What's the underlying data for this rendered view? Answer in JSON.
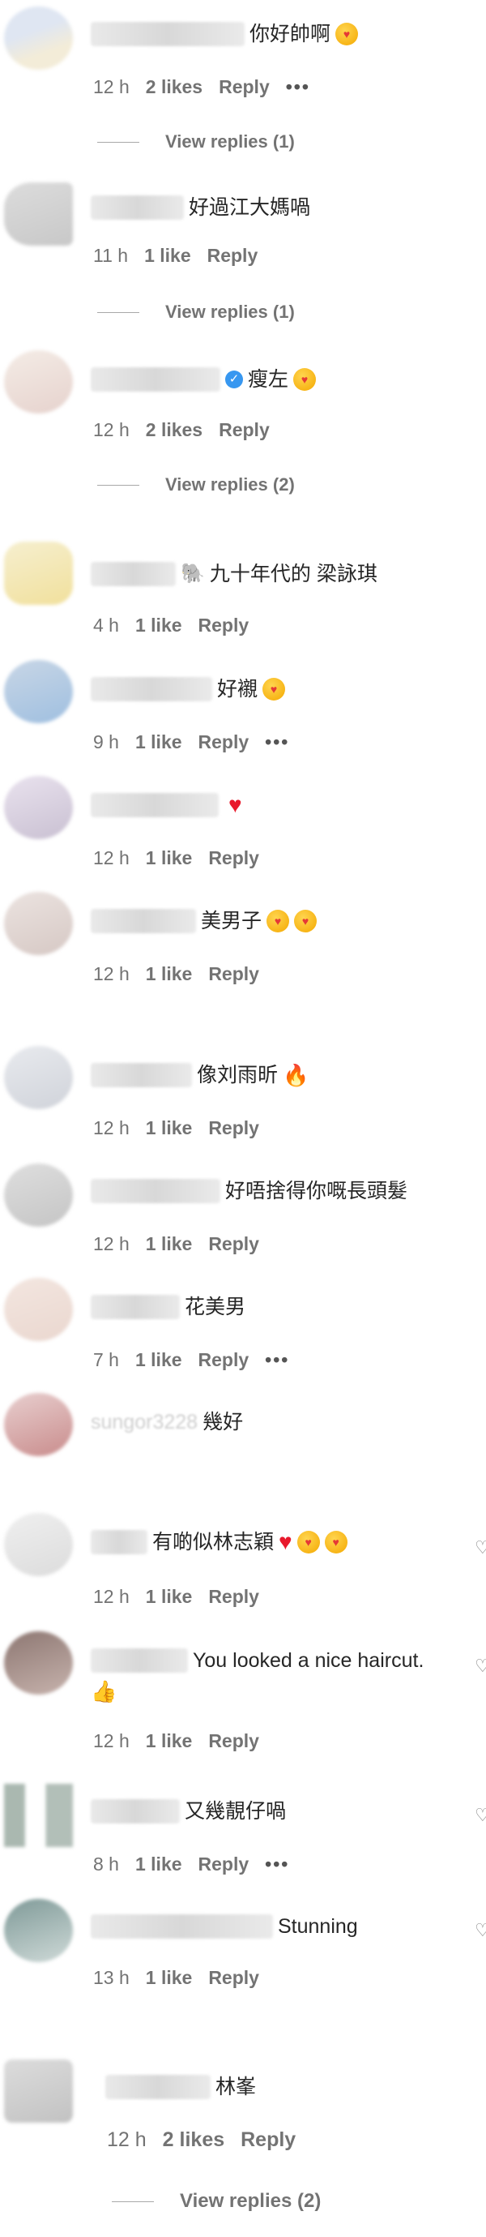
{
  "comments": [
    {
      "id": "c1",
      "text": "你好帥啊",
      "time": "12 h",
      "likes": "2 likes",
      "reply": "Reply",
      "more": "•••",
      "view_replies": "View replies (1)"
    },
    {
      "id": "c2",
      "text": "好過江大媽喎",
      "time": "11 h",
      "likes": "1 like",
      "reply": "Reply",
      "view_replies": "View replies (1)"
    },
    {
      "id": "c3",
      "text": "瘦左",
      "time": "12 h",
      "likes": "2 likes",
      "reply": "Reply",
      "view_replies": "View replies (2)"
    },
    {
      "id": "c4",
      "text": "九十年代的 梁詠琪",
      "time": "4 h",
      "likes": "1 like",
      "reply": "Reply"
    },
    {
      "id": "c5",
      "text": "好襯",
      "time": "9 h",
      "likes": "1 like",
      "reply": "Reply",
      "more": "•••"
    },
    {
      "id": "c6",
      "text": "",
      "time": "12 h",
      "likes": "1 like",
      "reply": "Reply"
    },
    {
      "id": "c7",
      "text": "美男子",
      "time": "12 h",
      "likes": "1 like",
      "reply": "Reply"
    },
    {
      "id": "c8",
      "text": "像刘雨昕",
      "time": "12 h",
      "likes": "1 like",
      "reply": "Reply"
    },
    {
      "id": "c9",
      "text": "好唔捨得你嘅長頭髮",
      "time": "12 h",
      "likes": "1 like",
      "reply": "Reply"
    },
    {
      "id": "c10",
      "text": "花美男",
      "time": "7 h",
      "likes": "1 like",
      "reply": "Reply",
      "more": "•••"
    },
    {
      "id": "c11",
      "text": "幾好",
      "username": "sungor3228"
    },
    {
      "id": "c12",
      "text": "有啲似林志穎",
      "time": "12 h",
      "likes": "1 like",
      "reply": "Reply"
    },
    {
      "id": "c13",
      "text": "You looked a nice haircut.",
      "time": "12 h",
      "likes": "1 like",
      "reply": "Reply"
    },
    {
      "id": "c14",
      "text": "又幾靚仔喎",
      "time": "8 h",
      "likes": "1 like",
      "reply": "Reply",
      "more": "•••"
    },
    {
      "id": "c15",
      "text": "Stunning",
      "time": "13 h",
      "likes": "1 like",
      "reply": "Reply"
    },
    {
      "id": "c16",
      "text": "林峯",
      "time": "12 h",
      "likes": "2 likes",
      "reply": "Reply",
      "view_replies": "View replies (2)"
    }
  ],
  "colors": {
    "meta": "#737373",
    "heart": "#e8192c",
    "verified": "#3797f0"
  }
}
